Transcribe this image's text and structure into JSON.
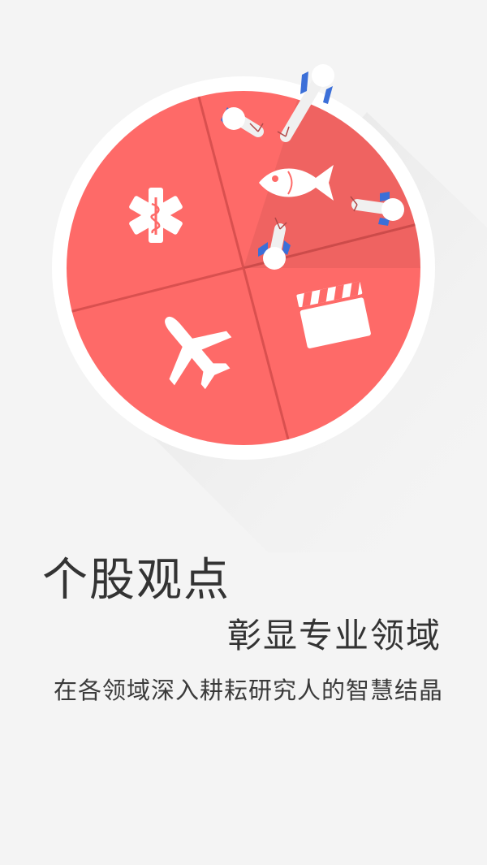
{
  "intro": {
    "title": "个股观点",
    "subtitle": "彰显专业领域",
    "tagline": "在各领域深入耕耘研究人的智慧结晶"
  },
  "illustration": {
    "sectors": [
      "medical-icon",
      "fish-icon",
      "airplane-icon",
      "clapperboard-icon"
    ],
    "pins": [
      "pin-icon",
      "pin-icon",
      "pin-icon",
      "pin-icon"
    ],
    "colors": {
      "disc": "#fe6a68",
      "rim": "#ffffff",
      "divider": "#d9504f",
      "icon": "#ffffff",
      "pin_blue": "#3b6fd8",
      "shadow": "#e2e2e2"
    }
  }
}
